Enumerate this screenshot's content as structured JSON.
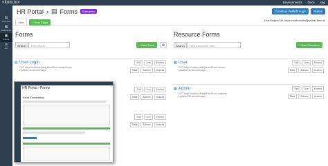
{
  "topbar": {
    "logo": "<form.io>",
    "environments": "Environments",
    "docs": "Docs",
    "user": "sag"
  },
  "sidebar": {
    "items": [
      {
        "label": "Overview",
        "glyph": "▤"
      },
      {
        "label": "Resources",
        "glyph": "▦"
      },
      {
        "label": "Forms",
        "glyph": "▣"
      },
      {
        "label": "API",
        "glyph": "⚙"
      }
    ]
  },
  "header": {
    "title": "HR Portal",
    "page": "Forms",
    "badge": "Enterprise",
    "continue": "Continue Walkthrough",
    "teams": "Teams",
    "live_tab": "Live",
    "new_stage": "+ New Stage",
    "live_url": "Live Project Url: https://xwfcxsclfwkjsz.test-form.io"
  },
  "forms": {
    "title": "Forms",
    "search_label": "Search",
    "search_placeholder": "Find a form...",
    "new_button": "+ New Form",
    "items": [
      {
        "name": "User Login",
        "get": "GET https://xwfcxsclfwkjsz.test-form.io/user/login",
        "updated": "Updated 11 seconds ago"
      }
    ]
  },
  "resources": {
    "title": "Resource Forms",
    "search_label": "Search",
    "search_placeholder": "Find a resource form...",
    "new_button": "+ New Resource",
    "items": [
      {
        "name": "User",
        "get": "GET https://xwfcxsclfwkjsz.test-form.io/user",
        "updated": "Updated 11 seconds ago"
      },
      {
        "name": "Admin",
        "get": "GET https://xwfcxsclfwkjsz.test-form.io/admin",
        "updated": "Updated 11 seconds ago"
      }
    ]
  },
  "actions": {
    "edit": "Edit",
    "live": "Live",
    "embed": "Embed",
    "data": "Data",
    "actions": "Actions",
    "access": "Access"
  },
  "inset": {
    "title": "HR Portal",
    "page": "Forms",
    "subtitle": "Form Embedding"
  }
}
